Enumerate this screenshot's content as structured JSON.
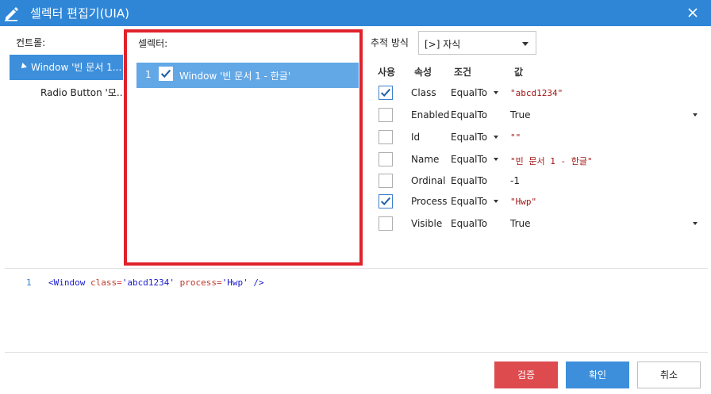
{
  "window": {
    "title": "셀렉터 편집기(UIA)"
  },
  "controls_panel": {
    "label": "컨트롤:",
    "items": [
      {
        "label": "Window '빈 문서 1...",
        "expanded": true,
        "selected": true
      },
      {
        "label": "Radio Button '모..."
      }
    ]
  },
  "selector_panel": {
    "label": "셀렉터:",
    "items": [
      {
        "index": "1",
        "checked": true,
        "label": "Window '빈 문서 1 - 한글'"
      }
    ]
  },
  "tracking": {
    "label": "추적 방식",
    "selected": "[>] 자식"
  },
  "properties": {
    "headers": {
      "use": "사용",
      "attribute": "속성",
      "condition": "조건",
      "value": "값"
    },
    "rows": [
      {
        "checked": true,
        "attribute": "Class",
        "condition": "EqualTo",
        "value": "\"abcd1234\""
      },
      {
        "checked": false,
        "attribute": "Enabled",
        "condition": "EqualTo",
        "value": "True"
      },
      {
        "checked": false,
        "attribute": "Id",
        "condition": "EqualTo",
        "value": "\"\""
      },
      {
        "checked": false,
        "attribute": "Name",
        "condition": "EqualTo",
        "value": "\"빈 문서 1 - 한글\""
      },
      {
        "checked": false,
        "attribute": "Ordinal",
        "condition": "EqualTo",
        "value": "-1"
      },
      {
        "checked": true,
        "attribute": "Process",
        "condition": "EqualTo",
        "value": "\"Hwp\""
      },
      {
        "checked": false,
        "attribute": "Visible",
        "condition": "EqualTo",
        "value": "True"
      }
    ]
  },
  "code_editor": {
    "line_number": "1",
    "tag_open": "<Window ",
    "attr1": "class=",
    "val1": "'abcd1234'",
    "attr2": " process=",
    "val2": "'Hwp'",
    "tag_close": " />"
  },
  "buttons": {
    "validate": "검증",
    "ok": "확인",
    "cancel": "취소"
  },
  "colors": {
    "titlebar": "#2f86d7",
    "selection": "#3d8fdb",
    "highlight_border": "#e0222b",
    "validate_button": "#dd4b4f"
  }
}
